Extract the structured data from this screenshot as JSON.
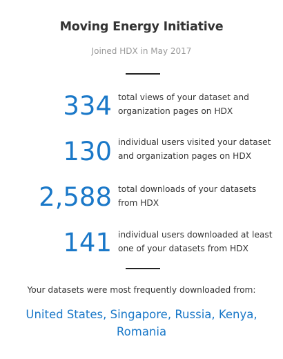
{
  "header": {
    "title": "Moving Energy Initiative",
    "joined": "Joined HDX in May 2017"
  },
  "stats": [
    {
      "value": "334",
      "description": "total views of your dataset and organization pages on HDX"
    },
    {
      "value": "130",
      "description": "individual users visited your dataset and organization pages on HDX"
    },
    {
      "value": "2,588",
      "description": "total downloads of your datasets from HDX"
    },
    {
      "value": "141",
      "description": "individual users downloaded at least one of your datasets from HDX"
    }
  ],
  "downloads": {
    "heading": "Your datasets were most frequently downloaded from:",
    "countries": "United States, Singapore, Russia, Kenya, Romania"
  },
  "colors": {
    "accent": "#1a78c8",
    "text": "#333333",
    "muted": "#999999"
  }
}
